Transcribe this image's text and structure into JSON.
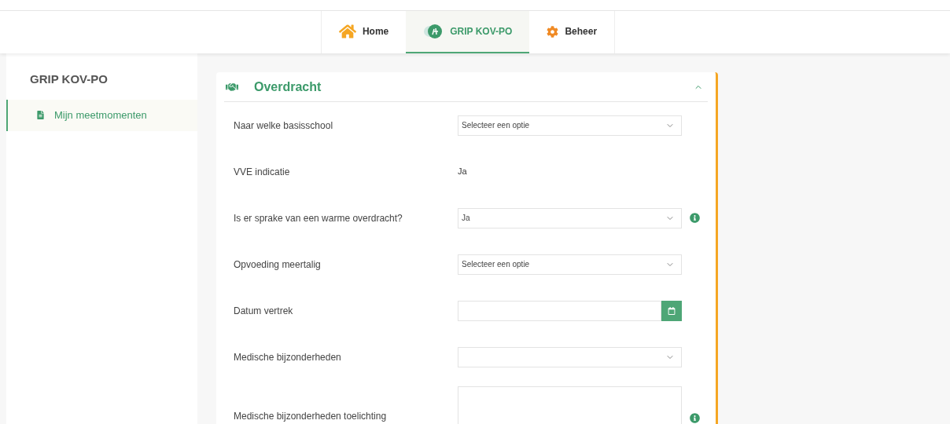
{
  "nav": [
    {
      "label": "Home",
      "kind": "home",
      "selected": false
    },
    {
      "label": "GRIP KOV-PO",
      "kind": "logo",
      "selected": true
    },
    {
      "label": "Beheer",
      "kind": "gear",
      "selected": false
    }
  ],
  "sidebar": {
    "title": "GRIP KOV-PO",
    "items": [
      {
        "label": "Mijn meetmomenten",
        "selected": true
      }
    ]
  },
  "section": {
    "title": "Overdracht",
    "expanded": true,
    "fields": [
      {
        "label": "Naar welke basisschool",
        "kind": "select",
        "placeholder": "Selecteer een optie",
        "info": false
      },
      {
        "label": "VVE indicatie",
        "kind": "static",
        "value": "Ja",
        "info": false
      },
      {
        "label": "Is er sprake van een warme overdracht?",
        "kind": "select",
        "value": "Ja",
        "info": true
      },
      {
        "label": "Opvoeding meertalig",
        "kind": "select",
        "placeholder": "Selecteer een optie",
        "info": false
      },
      {
        "label": "Datum vertrek",
        "kind": "date",
        "info": false
      },
      {
        "label": "Medische bijzonderheden",
        "kind": "select",
        "info": false
      },
      {
        "label": "Medische bijzonderheden toelichting",
        "kind": "textarea",
        "info": true
      }
    ]
  }
}
